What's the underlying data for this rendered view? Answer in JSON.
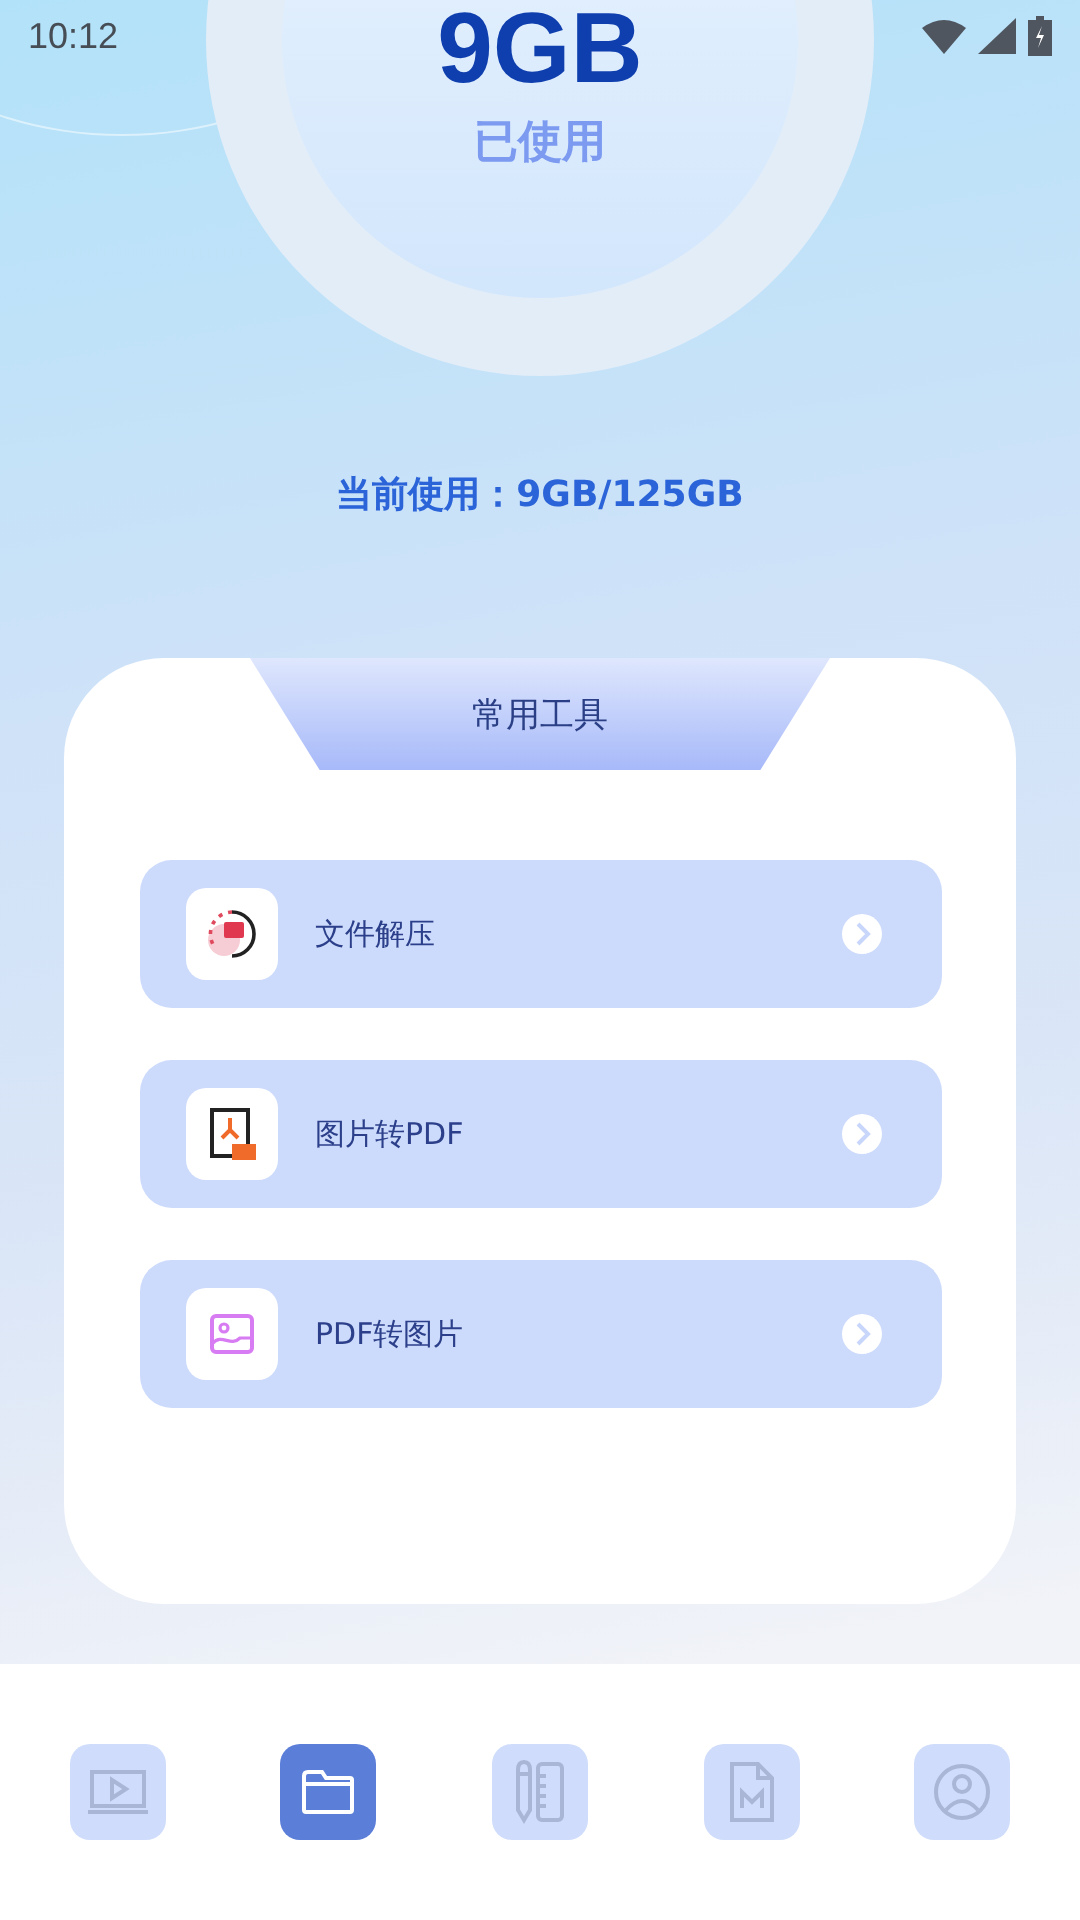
{
  "status_bar": {
    "time": "10:12"
  },
  "storage": {
    "amount": "9GB",
    "caption": "已使用",
    "summary": "当前使用：9GB/125GB"
  },
  "tools_card": {
    "title": "常用工具",
    "items": [
      {
        "kind": "unzip",
        "label": "文件解压"
      },
      {
        "kind": "image_to_pdf",
        "label": "图片转PDF"
      },
      {
        "kind": "pdf_to_image",
        "label": "PDF转图片"
      }
    ]
  },
  "bottom_nav": [
    {
      "kind": "video",
      "selected": false
    },
    {
      "kind": "files",
      "selected": true
    },
    {
      "kind": "notes",
      "selected": false
    },
    {
      "kind": "markdown",
      "selected": false
    },
    {
      "kind": "profile",
      "selected": false
    }
  ]
}
